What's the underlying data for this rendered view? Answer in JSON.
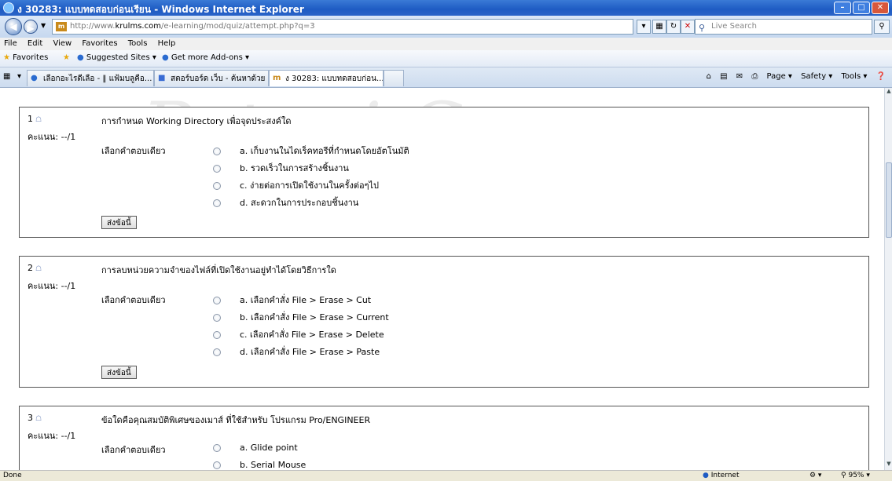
{
  "window": {
    "title": "ง 30283: แบบทดสอบก่อนเรียน - Windows Internet Explorer"
  },
  "address": {
    "url_prefix": "http://www.",
    "url_domain": "krulms.com",
    "url_path": "/e-learning/mod/quiz/attempt.php?q=3",
    "search_placeholder": "Live Search"
  },
  "menu": [
    "File",
    "Edit",
    "View",
    "Favorites",
    "Tools",
    "Help"
  ],
  "favorites": {
    "label": "Favorites",
    "items": [
      "Suggested Sites ▾",
      "Get more Add-ons ▾"
    ]
  },
  "tabs": [
    {
      "label": "เลือกอะไรดีเลือ - ‖ แฟ้มบลูคือ..."
    },
    {
      "label": "สตอร์บอร์ด เว็บ - ค้นหาด้วย G..."
    },
    {
      "label": "ง 30283: แบบทดสอบก่อน..."
    }
  ],
  "toolbar": {
    "page": "Page ▾",
    "safety": "Safety ▾",
    "tools": "Tools ▾"
  },
  "watermark": {
    "line1": "Patani Campus",
    "line2": "Patani"
  },
  "questions": [
    {
      "number": "1",
      "text": "การกำหนด Working Directory เพื่อจุดประสงค์ใด",
      "score": "คะแนน: --/1",
      "prompt": "เลือกคำตอบเดียว",
      "options": [
        "a. เก็บงานในไดเร็คทอรีที่กำหนดโดยอัตโนมัติ",
        "b. รวดเร็วในการสร้างชิ้นงาน",
        "c. ง่ายต่อการเปิดใช้งานในครั้งต่อๆไป",
        "d. สะดวกในการประกอบชิ้นงาน"
      ],
      "submit": "ส่งข้อนี้"
    },
    {
      "number": "2",
      "text": "การลบหน่วยความจำของไฟล์ที่เปิดใช้งานอยู่ทำได้โดยวิธีการใด",
      "score": "คะแนน: --/1",
      "prompt": "เลือกคำตอบเดียว",
      "options": [
        "a. เลือกคำสั่ง File > Erase > Cut",
        "b. เลือกคำสั่ง File > Erase > Current",
        "c. เลือกคำสั่ง File > Erase > Delete",
        "d. เลือกคำสั่ง File > Erase > Paste"
      ],
      "submit": "ส่งข้อนี้"
    },
    {
      "number": "3",
      "text": "ข้อใดคือคุณสมบัติพิเศษของเมาส์ ที่ใช้สำหรับ โปรแกรม Pro/ENGINEER",
      "score": "คะแนน: --/1",
      "prompt": "เลือกคำตอบเดียว",
      "options": [
        "a. Glide point",
        "b. Serial Mouse"
      ]
    }
  ],
  "status": {
    "left": "Done",
    "zone": "Internet",
    "zoom": "95%"
  }
}
